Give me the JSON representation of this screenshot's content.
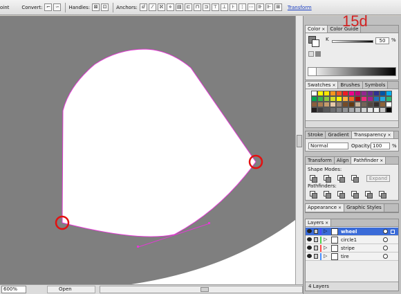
{
  "control_bar": {
    "fragment": "oint",
    "convert_label": "Convert:",
    "handles_label": "Handles:",
    "anchors_label": "Anchors:",
    "transform_link": "Transform"
  },
  "annotation": {
    "step_label": "15d"
  },
  "status_bar": {
    "zoom": "600%",
    "status": "Open"
  },
  "color_panel": {
    "tabs": [
      {
        "label": "Color"
      },
      {
        "label": "Color Guide"
      }
    ],
    "channel": "K",
    "value": "50",
    "unit": "%"
  },
  "swatches_panel": {
    "tabs": [
      {
        "label": "Swatches"
      },
      {
        "label": "Brushes"
      },
      {
        "label": "Symbols"
      }
    ],
    "colors": [
      "#ffffff",
      "#ffff00",
      "#ffe600",
      "#f7941d",
      "#f15a24",
      "#ed1c24",
      "#ec008c",
      "#c2007a",
      "#92278f",
      "#662d91",
      "#2e3192",
      "#0054a6",
      "#00aeef",
      "#00a651",
      "#39b54a",
      "#8dc63f",
      "#d7df23",
      "#fff200",
      "#fbb040",
      "#f26522",
      "#9e0b0f",
      "#ee2a7b",
      "#a3228f",
      "#1b75bc",
      "#27aae1",
      "#2bb673",
      "#8b5e3c",
      "#a97c50",
      "#c69c6d",
      "#e6c9a8",
      "#998675",
      "#754c29",
      "#603913",
      "#c7b299",
      "#736357",
      "#534741",
      "#362f2d",
      "#8c6239",
      "#ffffff",
      "#231f20",
      "#414042",
      "#58595b",
      "#6d6e71",
      "#808285",
      "#939598",
      "#a7a9ac",
      "#bcbec0",
      "#d1d3d4",
      "#e6e7e8",
      "#f1f2f2",
      "#c8c8c8",
      "#000000"
    ]
  },
  "transparency_panel": {
    "tabs": [
      {
        "label": "Stroke"
      },
      {
        "label": "Gradient"
      },
      {
        "label": "Transparency"
      }
    ],
    "blend_mode": "Normal",
    "opacity_label": "Opacity:",
    "opacity_value": "100",
    "opacity_unit": "%"
  },
  "pathfinder_panel": {
    "tabs": [
      {
        "label": "Transform"
      },
      {
        "label": "Align"
      },
      {
        "label": "Pathfinder"
      }
    ],
    "shape_modes_label": "Shape Modes:",
    "pathfinders_label": "Pathfinders:",
    "expand_label": "Expand"
  },
  "appearance_panel": {
    "tabs": [
      {
        "label": "Appearance"
      },
      {
        "label": "Graphic Styles"
      }
    ]
  },
  "layers_panel": {
    "tab": "Layers",
    "layers": [
      {
        "name": "wheel",
        "color": "#4a4aff",
        "selected": true
      },
      {
        "name": "circle1",
        "color": "#4ad44a",
        "selected": false
      },
      {
        "name": "stripe",
        "color": "#ff4a4a",
        "selected": false
      },
      {
        "name": "tire",
        "color": "#4a90ff",
        "selected": false
      }
    ],
    "count_label": "4 Layers"
  }
}
